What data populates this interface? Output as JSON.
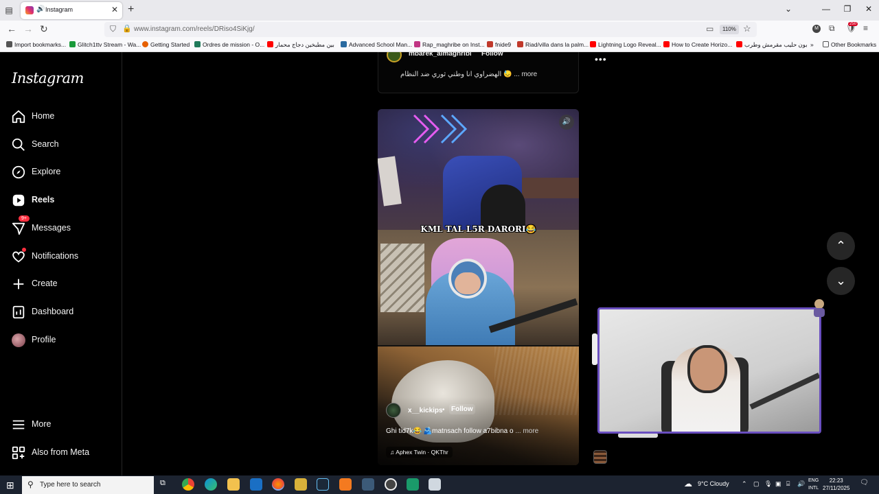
{
  "browser": {
    "tab": {
      "title": "Instagram",
      "audio_icon": "speaker-icon"
    },
    "url": "www.instagram.com/reels/DRiso4SiKjg/",
    "zoom": "110%",
    "extension_badge": "250",
    "account_initial": "M",
    "bookmarks": [
      {
        "label": "Import bookmarks...",
        "color": "#555555"
      },
      {
        "label": "Glitch1ttv Stream - Wa...",
        "color": "#1a9a3a"
      },
      {
        "label": "Getting Started",
        "color": "#e66000"
      },
      {
        "label": "Ordres de mission - O...",
        "color": "#1f7a5a"
      },
      {
        "label": "بين مطبخين دجاج محمار",
        "color": "#ff0000"
      },
      {
        "label": "Advanced School Man...",
        "color": "#2a6aa0"
      },
      {
        "label": "Rap_maghribe on Inst...",
        "color": "#c13584"
      },
      {
        "label": "fnide9",
        "color": "#c0392b"
      },
      {
        "label": "Riad/villa dans la palm...",
        "color": "#c0392b"
      },
      {
        "label": "Lightning Logo Reveal...",
        "color": "#ff0000"
      },
      {
        "label": "How to Create Horizo...",
        "color": "#ff0000"
      },
      {
        "label": "بون حليب مقرمش وطرب",
        "color": "#ff0000"
      }
    ],
    "other_bookmarks": "Other Bookmarks"
  },
  "sidebar": {
    "logo": "Instagram",
    "items": [
      {
        "label": "Home",
        "icon": "home-icon"
      },
      {
        "label": "Search",
        "icon": "search-icon"
      },
      {
        "label": "Explore",
        "icon": "compass-icon"
      },
      {
        "label": "Reels",
        "icon": "reels-icon",
        "active": true
      },
      {
        "label": "Messages",
        "icon": "messenger-icon",
        "badge": "9+"
      },
      {
        "label": "Notifications",
        "icon": "heart-icon"
      },
      {
        "label": "Create",
        "icon": "plus-icon"
      },
      {
        "label": "Dashboard",
        "icon": "dashboard-icon"
      },
      {
        "label": "Profile",
        "icon": "avatar"
      }
    ],
    "bottom": [
      {
        "label": "More",
        "icon": "menu-icon"
      },
      {
        "label": "Also from Meta",
        "icon": "meta-grid-icon"
      }
    ]
  },
  "previous_reel": {
    "username": "mbarek_almaghribi",
    "follow": "Follow",
    "caption": "الهضراوي انا وطني ثوري ضد النظام 😓 ... more"
  },
  "reel": {
    "banner_text": "KML TAL L5R DARORI😂",
    "username": "x__kickips",
    "follow": "Follow",
    "caption": "Ghi tid7k😂 🫂matnsach follow a7bibna o",
    "caption_more": "... more",
    "audio": "Aphex Twin · QKThr"
  },
  "taskbar": {
    "search_placeholder": "Type here to search",
    "weather": "9°C  Cloudy",
    "lang_top": "ENG",
    "lang_bottom": "INTL",
    "time": "22:23",
    "date": "27/11/2025",
    "notifications": "13"
  }
}
